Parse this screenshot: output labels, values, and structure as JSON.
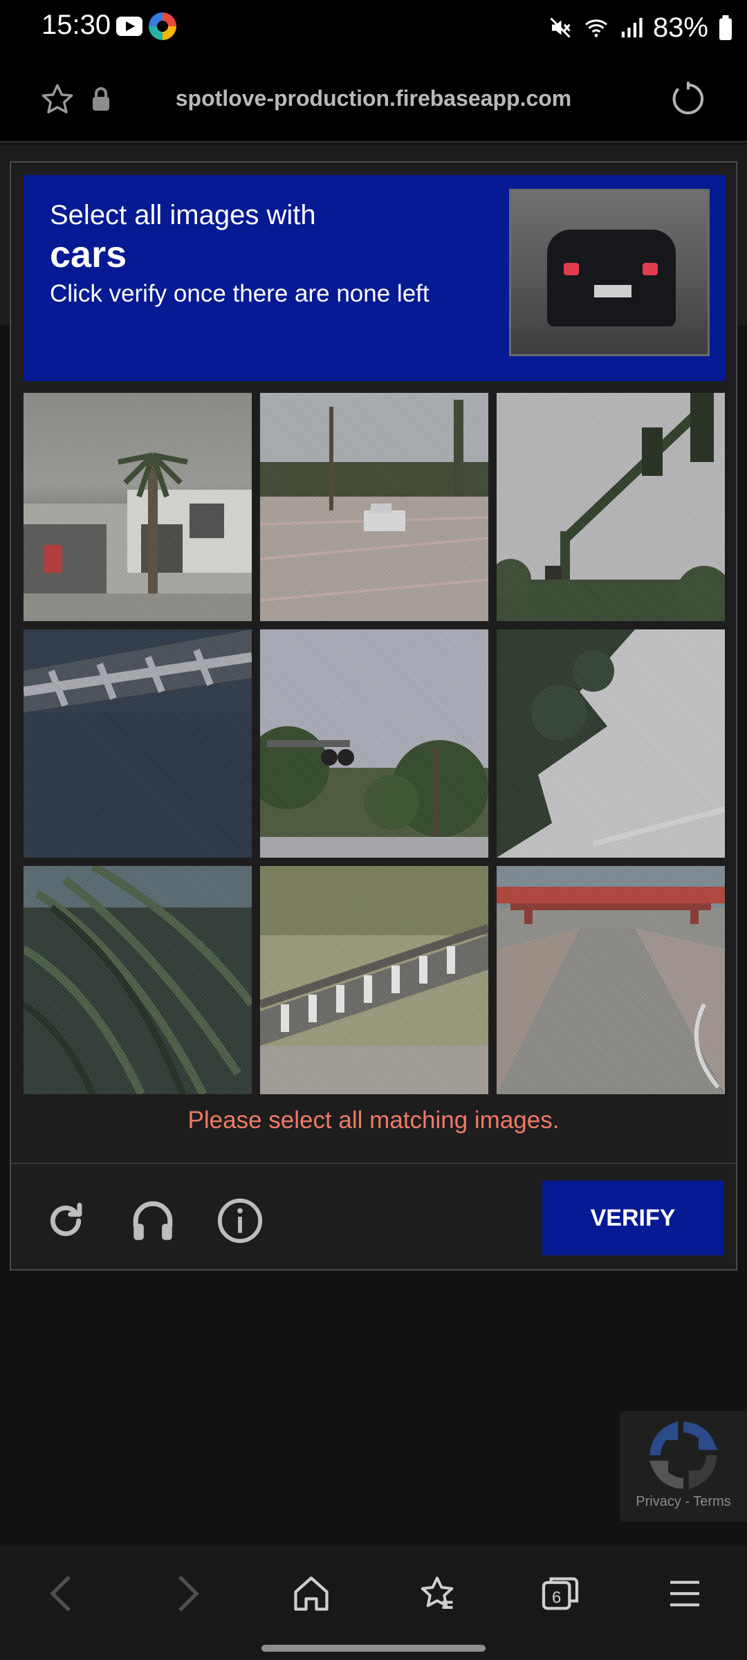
{
  "status_bar": {
    "time": "15:30",
    "battery": "83%",
    "icons": [
      "youtube-icon",
      "app-icon",
      "mute-icon",
      "wifi-icon",
      "signal-icon",
      "battery-icon"
    ]
  },
  "browser": {
    "url": "spotlove-production.firebaseapp.com",
    "icons": [
      "star-icon",
      "lock-icon",
      "reload-icon"
    ]
  },
  "captcha": {
    "prompt_line1": "Select all images with",
    "prompt_target": "cars",
    "prompt_line3": "Click verify once there are none left",
    "error": "Please select all matching images.",
    "verify_label": "VERIFY",
    "tiles": [
      {
        "name": "house-palm"
      },
      {
        "name": "road-truck"
      },
      {
        "name": "traffic-light-pole"
      },
      {
        "name": "building-shadow"
      },
      {
        "name": "traffic-signal-trees"
      },
      {
        "name": "tree-shadow-pavement"
      },
      {
        "name": "palm-fronds"
      },
      {
        "name": "bridge-railing"
      },
      {
        "name": "overpass-road"
      }
    ],
    "tool_icons": [
      "refresh-icon",
      "headphones-icon",
      "info-icon"
    ]
  },
  "recaptcha_badge": {
    "privacy": "Privacy",
    "separator": "-",
    "terms": "Terms"
  },
  "nav_bar": {
    "tab_count": "6",
    "icons": [
      "back-icon",
      "forward-icon",
      "home-icon",
      "bookmarks-icon",
      "tabs-icon",
      "menu-icon"
    ]
  }
}
